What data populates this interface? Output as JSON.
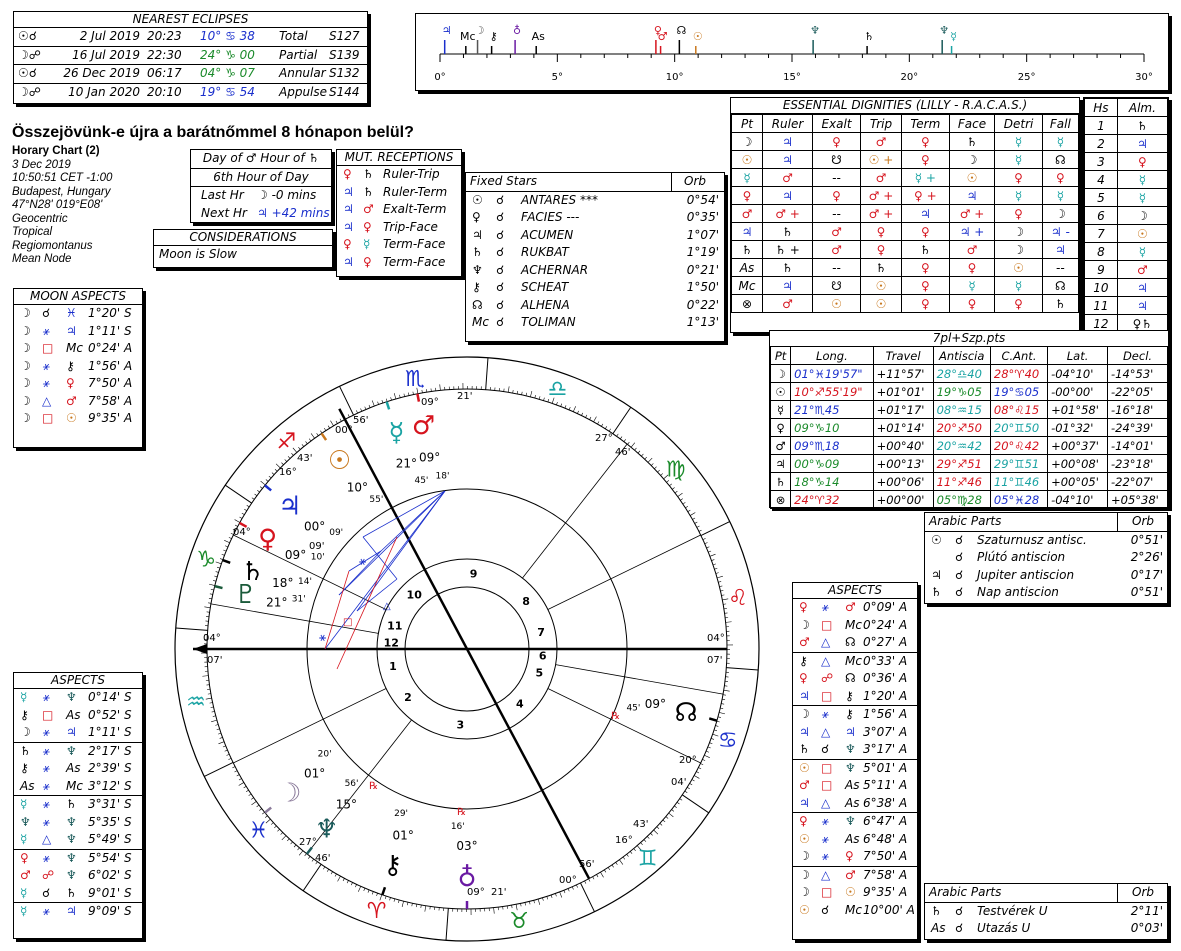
{
  "eclipses": {
    "title": "NEAREST ECLIPSES",
    "rows": [
      {
        "icon": "☉☌",
        "date": "2 Jul 2019",
        "time": "20:23",
        "pos": "10° ♋ 38",
        "type": "Total",
        "saros": "S127",
        "poscolor": "#1a2fcc"
      },
      {
        "icon": "☽☍",
        "date": "16 Jul 2019",
        "time": "22:30",
        "pos": "24° ♑ 00",
        "type": "Partial",
        "saros": "S139",
        "poscolor": "#1a8a2a"
      },
      {
        "icon": "☉☌",
        "date": "26 Dec 2019",
        "time": "06:17",
        "pos": "04° ♑ 07",
        "type": "Annular",
        "saros": "S132",
        "poscolor": "#1a8a2a"
      },
      {
        "icon": "☽☍",
        "date": "10 Jan 2020",
        "time": "20:10",
        "pos": "19° ♋ 54",
        "type": "Appulse",
        "saros": "S144",
        "poscolor": "#1a2fcc"
      }
    ]
  },
  "chart_info": {
    "title": "Összejövünk-e újra a barátnőmmel 8 hónapon belül?",
    "subtitle": "Horary Chart (2)",
    "lines": [
      "3 Dec 2019",
      "10:50:51  CET -1:00",
      "Budapest, Hungary",
      "47°N28' 019°E08'",
      "Geocentric",
      "Tropical",
      "Regiomontanus",
      "Mean Node"
    ]
  },
  "hour": {
    "row1": "Day of ♂ Hour of ♄",
    "row2": "6th Hour of Day",
    "last_label": "Last Hr",
    "last_value": "☽  -0 mins",
    "next_label": "Next Hr",
    "next_value": "♃  +42 mins"
  },
  "considerations": {
    "title": "CONSIDERATIONS",
    "text": "Moon is Slow"
  },
  "mut_receptions": {
    "title": "MUT. RECEPTIONS",
    "rows": [
      {
        "a": "♀",
        "b": "♄",
        "t": "Ruler-Trip"
      },
      {
        "a": "♃",
        "b": "♄",
        "t": "Ruler-Term"
      },
      {
        "a": "♃",
        "b": "♂",
        "t": "Exalt-Term"
      },
      {
        "a": "♃",
        "b": "♀",
        "t": "Trip-Face"
      },
      {
        "a": "♀",
        "b": "☿",
        "t": "Term-Face"
      },
      {
        "a": "♃",
        "b": "♀",
        "t": "Term-Face"
      }
    ]
  },
  "fixed_stars": {
    "title": "Fixed Stars",
    "orb_label": "Orb",
    "rows": [
      {
        "p": "☉",
        "star": "ANTARES ***",
        "orb": "0°54'"
      },
      {
        "p": "♀",
        "star": "FACIES ---",
        "orb": "0°35'"
      },
      {
        "p": "♃",
        "star": "ACUMEN",
        "orb": "1°07'"
      },
      {
        "p": "♄",
        "star": "RUKBAT",
        "orb": "1°19'"
      },
      {
        "p": "♆",
        "star": "ACHERNAR",
        "orb": "0°21'"
      },
      {
        "p": "⚷",
        "star": "SCHEAT",
        "orb": "1°50'"
      },
      {
        "p": "☊",
        "star": "ALHENA",
        "orb": "0°22'"
      },
      {
        "p": "Mc",
        "star": "TOLIMAN",
        "orb": "1°13'"
      }
    ]
  },
  "dignities": {
    "title": "ESSENTIAL DIGNITIES (LILLY - R.A.C.A.S.)",
    "headers": [
      "Pt",
      "Ruler",
      "Exalt",
      "Trip",
      "Term",
      "Face",
      "Detri",
      "Fall"
    ],
    "rows": [
      [
        "☽",
        "♃",
        "♀",
        "♂",
        "♀",
        "♄",
        "☿",
        "☿"
      ],
      [
        "☉",
        "♃",
        "☋",
        "☉ +",
        "♀",
        "☽",
        "☿",
        "☊"
      ],
      [
        "☿",
        "♂",
        "--",
        "♂",
        "☿ +",
        "☉",
        "♀",
        "♀"
      ],
      [
        "♀",
        "♃",
        "♀",
        "♂ +",
        "♀ +",
        "♃",
        "☿",
        "☿"
      ],
      [
        "♂",
        "♂ +",
        "--",
        "♂ +",
        "♃",
        "♂ +",
        "♀",
        "☽"
      ],
      [
        "♃",
        "♄",
        "♂",
        "♀",
        "♀",
        "♃ +",
        "☽",
        "♃ -"
      ],
      [
        "♄",
        "♄ +",
        "♂",
        "♀",
        "♄",
        "♂",
        "☽",
        "♃"
      ],
      [
        "As",
        "♄",
        "--",
        "♄",
        "♀",
        "♀",
        "☉",
        "--"
      ],
      [
        "Mc",
        "♃",
        "☋",
        "☉",
        "♀",
        "☿",
        "☿",
        "☊"
      ],
      [
        "⊗",
        "♂",
        "☉",
        "☉",
        "♀",
        "♀",
        "♀",
        "♄"
      ]
    ]
  },
  "houses_alm": {
    "h_label": "Hs",
    "alm_label": "Alm.",
    "rows": [
      [
        "1",
        "♄"
      ],
      [
        "2",
        "♃"
      ],
      [
        "3",
        "♀"
      ],
      [
        "4",
        "☿"
      ],
      [
        "5",
        "☿"
      ],
      [
        "6",
        "☽"
      ],
      [
        "7",
        "☉"
      ],
      [
        "8",
        "☿"
      ],
      [
        "9",
        "♂"
      ],
      [
        "10",
        "♃"
      ],
      [
        "11",
        "♃"
      ],
      [
        "12",
        "♀♄"
      ]
    ]
  },
  "positions": {
    "title": "7pl+Szp.pts",
    "headers": [
      "Pt",
      "Long.",
      "Travel",
      "Antiscia",
      "C.Ant.",
      "Lat.",
      "Decl."
    ],
    "rows": [
      {
        "pt": "☽",
        "long": "01°♓19'57\"",
        "travel": "+11°57'",
        "ant": "28°♎40",
        "cant": "28°♈40",
        "lat": "-04°10'",
        "decl": "-14°53'",
        "lc": "#1a2fcc",
        "ac": "#1aa3a3",
        "cc": "#d6141e"
      },
      {
        "pt": "☉",
        "long": "10°♐55'19\"",
        "travel": "+01°01'",
        "ant": "19°♑05",
        "cant": "19°♋05",
        "lat": "-00°00'",
        "decl": "-22°05'",
        "lc": "#d6141e",
        "ac": "#1a8a2a",
        "cc": "#1a2fcc"
      },
      {
        "pt": "☿",
        "long": "21°♏45",
        "travel": "+01°17'",
        "ant": "08°♒15",
        "cant": "08°♌15",
        "lat": "+01°58'",
        "decl": "-16°18'",
        "lc": "#1a2fcc",
        "ac": "#1aa3a3",
        "cc": "#d6141e"
      },
      {
        "pt": "♀",
        "long": "09°♑10",
        "travel": "+01°14'",
        "ant": "20°♐50",
        "cant": "20°♊50",
        "lat": "-01°32'",
        "decl": "-24°39'",
        "lc": "#1a8a2a",
        "ac": "#d6141e",
        "cc": "#1aa3a3"
      },
      {
        "pt": "♂",
        "long": "09°♏18",
        "travel": "+00°40'",
        "ant": "20°♒42",
        "cant": "20°♌42",
        "lat": "+00°37'",
        "decl": "-14°01'",
        "lc": "#1a2fcc",
        "ac": "#1aa3a3",
        "cc": "#d6141e"
      },
      {
        "pt": "♃",
        "long": "00°♑09",
        "travel": "+00°13'",
        "ant": "29°♐51",
        "cant": "29°♊51",
        "lat": "+00°08'",
        "decl": "-23°18'",
        "lc": "#1a8a2a",
        "ac": "#d6141e",
        "cc": "#1aa3a3"
      },
      {
        "pt": "♄",
        "long": "18°♑14",
        "travel": "+00°06'",
        "ant": "11°♐46",
        "cant": "11°♊46",
        "lat": "+00°05'",
        "decl": "-22°07'",
        "lc": "#1a8a2a",
        "ac": "#d6141e",
        "cc": "#1aa3a3"
      },
      {
        "pt": "⊗",
        "long": "24°♈32",
        "travel": "+00°00'",
        "ant": "05°♍28",
        "cant": "05°♓28",
        "lat": "-04°10'",
        "decl": "+05°38'",
        "lc": "#d6141e",
        "ac": "#1a8a2a",
        "cc": "#1a2fcc"
      }
    ]
  },
  "arabic1": {
    "title": "Arabic Parts",
    "orb_label": "Orb",
    "rows": [
      {
        "p": "☉",
        "a": "☌",
        "name": "Szaturnusz antisc.",
        "orb": "0°51'"
      },
      {
        "p": "",
        "a": "☌",
        "name": "Plútó antiscion",
        "orb": "2°26'"
      },
      {
        "p": "♃",
        "a": "☌",
        "name": "Jupiter antiscion",
        "orb": "0°17'"
      },
      {
        "p": "♄",
        "a": "☌",
        "name": "Nap antiscion",
        "orb": "0°51'"
      }
    ]
  },
  "arabic2": {
    "title": "Arabic Parts",
    "orb_label": "Orb",
    "rows": [
      {
        "p": "♄",
        "a": "☌",
        "name": "Testvérek U",
        "orb": "2°11'"
      },
      {
        "p": "As",
        "a": "☌",
        "name": "Utazás U",
        "orb": "0°03'"
      }
    ]
  },
  "moon_aspects": {
    "title": "MOON ASPECTS",
    "rows": [
      {
        "a": "☽",
        "asp": "☌",
        "b": "♓",
        "orb": "1°20' S"
      },
      {
        "a": "☽",
        "asp": "⚹",
        "b": "♃",
        "orb": "1°11' S"
      },
      {
        "a": "☽",
        "asp": "□",
        "b": "Mc",
        "orb": "0°24' A"
      },
      {
        "a": "☽",
        "asp": "⚹",
        "b": "⚷",
        "orb": "1°56' A"
      },
      {
        "a": "☽",
        "asp": "⚹",
        "b": "♀",
        "orb": "7°50' A"
      },
      {
        "a": "☽",
        "asp": "△",
        "b": "♂",
        "orb": "7°58' A"
      },
      {
        "a": "☽",
        "asp": "□",
        "b": "☉",
        "orb": "9°35' A"
      }
    ]
  },
  "aspects_left": {
    "title": "ASPECTS",
    "rows": [
      {
        "a": "☿",
        "asp": "⚹",
        "b": "♆",
        "orb": "0°14' S"
      },
      {
        "a": "⚷",
        "asp": "□",
        "b": "As",
        "orb": "0°52' S"
      },
      {
        "a": "☽",
        "asp": "⚹",
        "b": "♃",
        "orb": "1°11' S"
      },
      {
        "a": "♄",
        "asp": "⚹",
        "b": "♆",
        "orb": "2°17' S"
      },
      {
        "a": "⚷",
        "asp": "⚹",
        "b": "As",
        "orb": "2°39' S"
      },
      {
        "a": "As",
        "asp": "⚹",
        "b": "Mc",
        "orb": "3°12' S"
      },
      {
        "a": "☿",
        "asp": "⚹",
        "b": "♄",
        "orb": "3°31' S"
      },
      {
        "a": "♆",
        "asp": "⚹",
        "b": "♆",
        "orb": "5°35' S"
      },
      {
        "a": "☿",
        "asp": "△",
        "b": "♆",
        "orb": "5°49' S"
      },
      {
        "a": "♀",
        "asp": "⚹",
        "b": "♆",
        "orb": "5°54' S"
      },
      {
        "a": "♂",
        "asp": "☍",
        "b": "♆",
        "orb": "6°02' S"
      },
      {
        "a": "☿",
        "asp": "☌",
        "b": "♄",
        "orb": "9°01' S"
      },
      {
        "a": "☿",
        "asp": "⚹",
        "b": "♃",
        "orb": "9°09' S"
      }
    ]
  },
  "aspects_right": {
    "title": "ASPECTS",
    "rows": [
      {
        "a": "♀",
        "asp": "⚹",
        "b": "♂",
        "orb": "0°09' A"
      },
      {
        "a": "☽",
        "asp": "□",
        "b": "Mc",
        "orb": "0°24' A"
      },
      {
        "a": "♂",
        "asp": "△",
        "b": "☊",
        "orb": "0°27' A"
      },
      {
        "a": "⚷",
        "asp": "△",
        "b": "Mc",
        "orb": "0°33' A"
      },
      {
        "a": "♀",
        "asp": "☍",
        "b": "☊",
        "orb": "0°36' A"
      },
      {
        "a": "♃",
        "asp": "□",
        "b": "⚷",
        "orb": "1°20' A"
      },
      {
        "a": "☽",
        "asp": "⚹",
        "b": "⚷",
        "orb": "1°56' A"
      },
      {
        "a": "♃",
        "asp": "△",
        "b": "♃",
        "orb": "3°07' A"
      },
      {
        "a": "♄",
        "asp": "☌",
        "b": "♆",
        "orb": "3°17' A"
      },
      {
        "a": "☉",
        "asp": "□",
        "b": "♆",
        "orb": "5°01' A"
      },
      {
        "a": "♂",
        "asp": "□",
        "b": "As",
        "orb": "5°11' A"
      },
      {
        "a": "♃",
        "asp": "△",
        "b": "As",
        "orb": "6°38' A"
      },
      {
        "a": "♀",
        "asp": "⚹",
        "b": "♆",
        "orb": "6°47' A"
      },
      {
        "a": "☉",
        "asp": "⚹",
        "b": "As",
        "orb": "6°48' A"
      },
      {
        "a": "☽",
        "asp": "⚹",
        "b": "♀",
        "orb": "7°50' A"
      },
      {
        "a": "☽",
        "asp": "△",
        "b": "♂",
        "orb": "7°58' A"
      },
      {
        "a": "☽",
        "asp": "□",
        "b": "☉",
        "orb": "9°35' A"
      },
      {
        "a": "☉",
        "asp": "☌",
        "b": "Mc",
        "orb": "10°00' A"
      }
    ]
  },
  "scale": {
    "ticks": [
      "0°",
      "5°",
      "10°",
      "15°",
      "20°",
      "25°",
      "30°"
    ],
    "glyphs": [
      {
        "g": "♃",
        "deg": 0.2,
        "c": "#1a2fcc"
      },
      {
        "g": "Mc",
        "deg": 1.1,
        "c": "#000"
      },
      {
        "g": "☽",
        "deg": 1.6,
        "c": "#555"
      },
      {
        "g": "⚷",
        "deg": 2.2,
        "c": "#000"
      },
      {
        "g": "♁",
        "deg": 3.2,
        "c": "#6a1aa3"
      },
      {
        "g": "As",
        "deg": 4.1,
        "c": "#000"
      },
      {
        "g": "♀",
        "deg": 9.2,
        "c": "#d6141e"
      },
      {
        "g": "♂",
        "deg": 9.4,
        "c": "#d6141e"
      },
      {
        "g": "☊",
        "deg": 10.2,
        "c": "#000"
      },
      {
        "g": "☉",
        "deg": 10.9,
        "c": "#c8781e"
      },
      {
        "g": "♆",
        "deg": 15.9,
        "c": "#1a5a5a"
      },
      {
        "g": "♄",
        "deg": 18.2,
        "c": "#000"
      },
      {
        "g": "♆",
        "deg": 21.4,
        "c": "#1a5a5a"
      },
      {
        "g": "☿",
        "deg": 21.8,
        "c": "#1aa3a3"
      }
    ]
  },
  "wheel": {
    "houses": [
      "1",
      "2",
      "3",
      "4",
      "5",
      "6",
      "7",
      "8",
      "9",
      "10",
      "11",
      "12"
    ],
    "planets": [
      {
        "g": "♂",
        "deg": "09°",
        "min": "18'",
        "c": "#d6141e"
      },
      {
        "g": "☿",
        "deg": "21°",
        "min": "45'",
        "c": "#1aa3a3"
      },
      {
        "g": "☉",
        "deg": "10°",
        "min": "55'",
        "c": "#c8781e"
      },
      {
        "g": "♃",
        "deg": "00°",
        "min": "09'",
        "c": "#1a2fcc"
      },
      {
        "g": "♀",
        "deg": "09°",
        "min": "10'",
        "c": "#d6141e"
      },
      {
        "g": "♄",
        "deg": "18°",
        "min": "14'",
        "c": "#000"
      },
      {
        "g": "♇",
        "deg": "21°",
        "min": "31'",
        "c": "#1a5a3a"
      },
      {
        "g": "☽",
        "deg": "01°",
        "min": "20'",
        "c": "#8a7a9a"
      },
      {
        "g": "♆",
        "deg": "15°",
        "min": "56'",
        "c": "#1a5a5a"
      },
      {
        "g": "⚷",
        "deg": "01°",
        "min": "29'",
        "c": "#000"
      },
      {
        "g": "♁",
        "deg": "03°",
        "min": "16'",
        "c": "#6a1aa3"
      },
      {
        "g": "☊",
        "deg": "09°",
        "min": "45'",
        "c": "#000"
      }
    ],
    "cusp_labels": {
      "asc_a": "04°",
      "asc_b": "07'",
      "dsc_a": "04°",
      "dsc_b": "07'",
      "mc_a": "00°",
      "mc_b": "56'",
      "ic_a": "00°",
      "ic_b": "56'",
      "c11_a": "27°",
      "c11_b": "46'",
      "c12_a": "16°",
      "c12_b": "43'",
      "c5_a": "20°",
      "c5_b": "04'",
      "c6_a": "16°",
      "c6_b": "43'",
      "c2_a": "27°",
      "c2_b": "46'",
      "c3_a": "04°",
      "c3_b": "09'",
      "c8_a": "09°",
      "c8_b": "21'",
      "c9_a": "09°",
      "c9_b": "21'"
    },
    "signs": [
      "♈",
      "♉",
      "♊",
      "♋",
      "♌",
      "♍",
      "♎",
      "♏",
      "♐",
      "♑",
      "♒",
      "♓"
    ],
    "retro": "℞"
  }
}
